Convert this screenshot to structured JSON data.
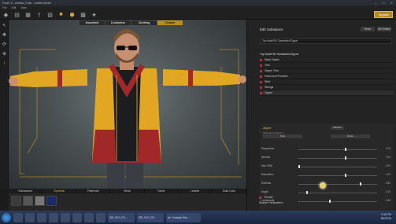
{
  "window": {
    "title": "Fuse1.3 - Untitled_Fuse - Unified Model"
  },
  "menu": [
    "File",
    "Edit",
    "View"
  ],
  "promo_button": "Upgrade",
  "viewport_tabs": [
    {
      "label": "Assemble",
      "active": false
    },
    {
      "label": "Customize",
      "active": false
    },
    {
      "label": "Clothing",
      "active": false
    },
    {
      "label": "Texture",
      "active": true
    }
  ],
  "bottom_tabs": [
    {
      "label": "Substances",
      "active": false
    },
    {
      "label": "Synthetic",
      "active": true
    },
    {
      "label": "Patterned",
      "active": false
    },
    {
      "label": "Metal",
      "active": false
    },
    {
      "label": "Fabric",
      "active": false
    },
    {
      "label": "Leather",
      "active": false
    },
    {
      "label": "Solid Color",
      "active": false
    }
  ],
  "thumb_colors": [
    "#3a3a3a",
    "#555555",
    "#777777",
    "#1b2b6a"
  ],
  "panel": {
    "title": "Edit Substance",
    "reset": "Reset",
    "set_default": "Set Default",
    "field": "Top:MaleFit0 Sweatshirt/Zipper",
    "materials_title": "Top:MaleFit0 Sweatshirt/Zipper",
    "materials": [
      {
        "label": "Main Fabric",
        "selected": false
      },
      {
        "label": "Trim",
        "selected": false
      },
      {
        "label": "Zipper Trim",
        "selected": false
      },
      {
        "label": "Hood and Pockets",
        "selected": false
      },
      {
        "label": "Shirt",
        "selected": false
      },
      {
        "label": "Strings",
        "selected": false
      },
      {
        "label": "Zipper",
        "selected": true
      }
    ],
    "zipper": {
      "name": "Zipper",
      "subtitle": "Galvanized Metal 4",
      "browse": "Browse",
      "tiles": "Tiles",
      "gloss": "Gloss",
      "sliders": [
        {
          "label": "Sharpness",
          "value": 0.6,
          "text": "1.00"
        },
        {
          "label": "Normal",
          "value": 0.6,
          "text": "1.00"
        },
        {
          "label": "Hue Shift",
          "value": 0.0,
          "text": "0.00"
        },
        {
          "label": "Saturation",
          "value": 0.6,
          "text": "1.00"
        },
        {
          "label": "Emboss",
          "value": 0.8,
          "text": "0.80"
        },
        {
          "label": "Angle",
          "value": 0.1,
          "text": "0.10"
        },
        {
          "label": "Luminosity",
          "value": 0.4,
          "text": "0.50"
        }
      ]
    },
    "thread": "Thread",
    "shader": "Shader Parameters"
  },
  "taskbar": {
    "tasks": [
      "SRI_SVC_FR...",
      "SRI_SVC_FR...",
      "Mr. Fantastic Ran..."
    ],
    "time": "2:46 PM",
    "date": "8/4/2015"
  },
  "colors": {
    "accent": "#b58c1e",
    "marker": "#b03030"
  }
}
